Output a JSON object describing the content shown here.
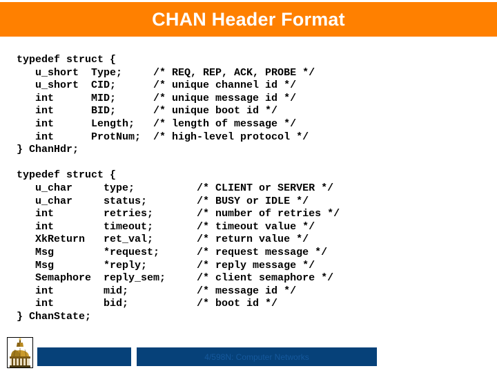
{
  "slide": {
    "title": "CHAN Header Format",
    "title_bar_color": "#ff8000",
    "title_text_color": "#ffffff",
    "background_color": "#ffffff"
  },
  "code": {
    "block_1": "typedef struct {\n   u_short  Type;     /* REQ, REP, ACK, PROBE */\n   u_short  CID;      /* unique channel id */\n   int      MID;      /* unique message id */\n   int      BID;      /* unique boot id */\n   int      Length;   /* length of message */\n   int      ProtNum;  /* high-level protocol */\n} ChanHdr;",
    "block_2": "typedef struct {\n   u_char     type;          /* CLIENT or SERVER */\n   u_char     status;        /* BUSY or IDLE */\n   int        retries;       /* number of retries */\n   int        timeout;       /* timeout value */\n   XkReturn   ret_val;       /* return value */\n   Msg        *request;      /* request message */\n   Msg        *reply;        /* reply message */\n   Semaphore  reply_sem;     /* client semaphore */\n   int        mid;           /* message id */\n   int        bid;           /* boot id */\n} ChanState;"
  },
  "footer": {
    "course_label": "4/598N: Computer Networks",
    "bar_color": "#064179",
    "text_color": "#15589c",
    "logo_alt": "university-dome-logo"
  }
}
